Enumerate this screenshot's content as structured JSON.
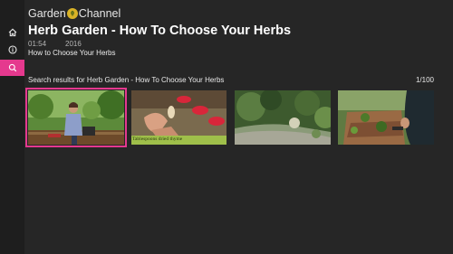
{
  "brand": {
    "name_left": "Garden",
    "name_right": "Channel"
  },
  "sidebar": {
    "items": [
      {
        "icon": "home-icon"
      },
      {
        "icon": "info-icon"
      },
      {
        "icon": "search-icon",
        "active": true
      }
    ],
    "accent_color": "#e5398e"
  },
  "video": {
    "title": "Herb Garden - How To Choose Your Herbs",
    "duration": "01:54",
    "year": "2016",
    "description": "How to Choose Your Herbs"
  },
  "results": {
    "label": "Search results for Herb Garden - How To Choose Your Herbs",
    "position": "1/100",
    "items": [
      {
        "selected": true,
        "caption": ""
      },
      {
        "selected": false,
        "caption": "Tablespoons dried thyme"
      },
      {
        "selected": false,
        "caption": ""
      },
      {
        "selected": false,
        "caption": ""
      }
    ]
  }
}
